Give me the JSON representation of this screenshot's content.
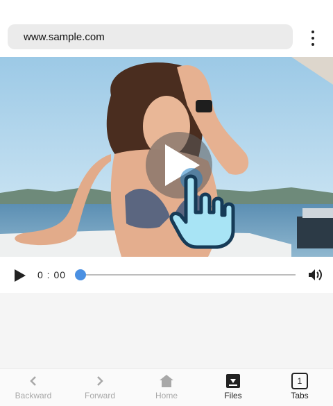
{
  "address_bar": {
    "url": "www.sample.com"
  },
  "player": {
    "time": "0 : 00",
    "progress": 0,
    "icons": {
      "play": "play-icon",
      "overlay": "play-circle-icon",
      "hand": "tap-hand-icon",
      "volume": "volume-icon"
    }
  },
  "nav": {
    "items": [
      {
        "label": "Backward",
        "icon": "chevron-left-icon",
        "enabled": false
      },
      {
        "label": "Forward",
        "icon": "chevron-right-icon",
        "enabled": false
      },
      {
        "label": "Home",
        "icon": "home-icon",
        "enabled": false
      },
      {
        "label": "Files",
        "icon": "download-box-icon",
        "enabled": true
      },
      {
        "label": "Tabs",
        "icon": "tabs-icon",
        "enabled": true,
        "count": "1"
      }
    ]
  },
  "colors": {
    "accent": "#4a90e2",
    "hand_fill": "#a8e4f5",
    "hand_stroke": "#163b57"
  }
}
